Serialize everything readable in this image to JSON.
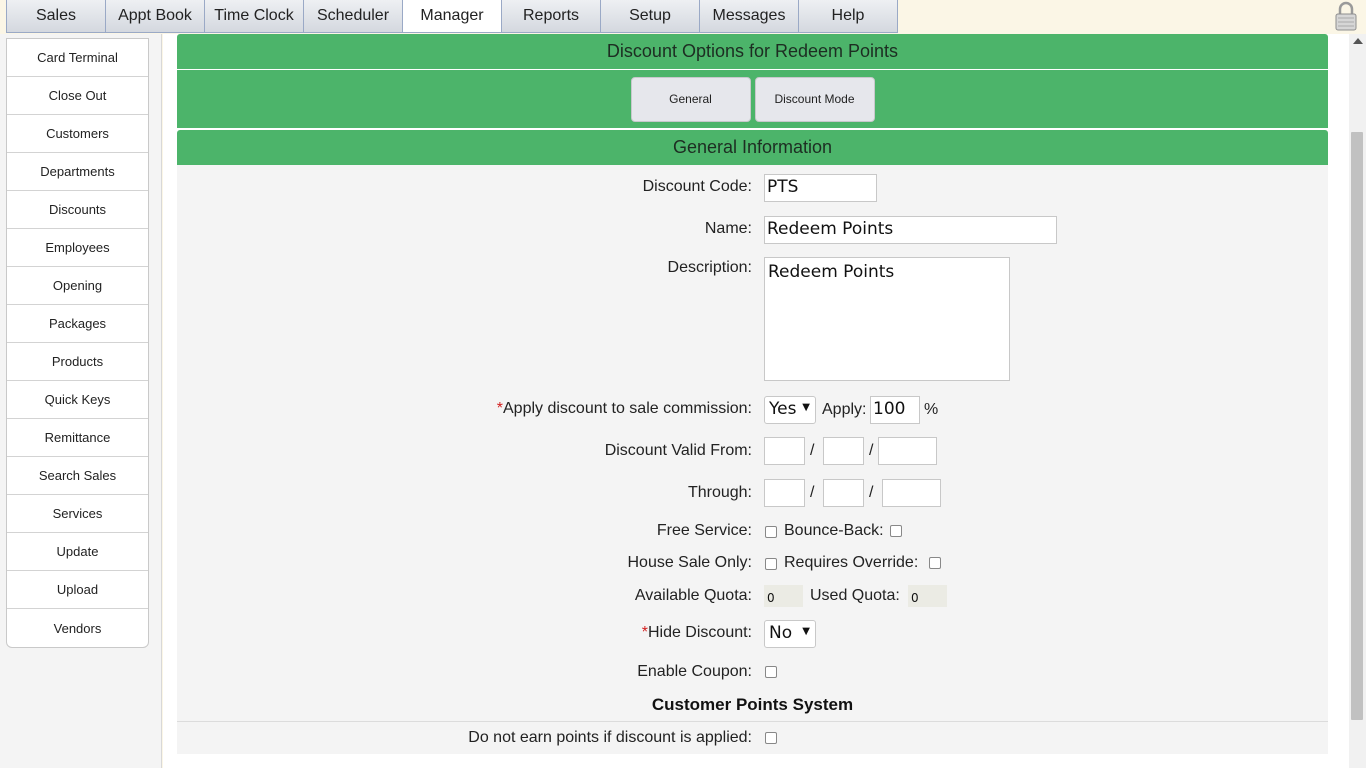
{
  "top_tabs": [
    "Sales",
    "Appt Book",
    "Time Clock",
    "Scheduler",
    "Manager",
    "Reports",
    "Setup",
    "Messages",
    "Help"
  ],
  "active_tab": "Manager",
  "sidebar": {
    "items": [
      "Card Terminal",
      "Close Out",
      "Customers",
      "Departments",
      "Discounts",
      "Employees",
      "Opening",
      "Packages",
      "Products",
      "Quick Keys",
      "Remittance",
      "Search Sales",
      "Services",
      "Update",
      "Upload",
      "Vendors"
    ]
  },
  "header": {
    "title": "Discount Options for Redeem Points"
  },
  "buttons": {
    "general": "General",
    "discount_mode": "Discount Mode"
  },
  "section": {
    "title": "General Information"
  },
  "form": {
    "discount_code_label": "Discount Code:",
    "discount_code_value": "PTS",
    "name_label": "Name:",
    "name_value": "Redeem Points",
    "description_label": "Description:",
    "description_value": "Redeem Points",
    "required_mark": "*",
    "apply_commission_label": "Apply discount to sale commission:",
    "apply_commission_value": "Yes",
    "apply_label": "Apply:",
    "apply_value": "100",
    "percent": "%",
    "valid_from_label": "Discount Valid From:",
    "through_label": "Through:",
    "slash": "/",
    "free_service_label": "Free Service:",
    "bounce_back_label": "Bounce-Back:",
    "house_sale_label": "House Sale Only:",
    "requires_override_label": "Requires Override:",
    "available_quota_label": "Available Quota:",
    "available_quota_value": "0",
    "used_quota_label": "Used Quota:",
    "used_quota_value": "0",
    "hide_discount_label": "Hide Discount:",
    "hide_discount_value": "No",
    "enable_coupon_label": "Enable Coupon:"
  },
  "points_section": {
    "title": "Customer Points System",
    "no_earn_label": "Do not earn points if discount is applied:"
  },
  "icons": {
    "lock": "lock-icon",
    "dropdown": "chevron-down-icon"
  },
  "colors": {
    "green_header": "#4cb46a",
    "form_bg": "#f4f4f4",
    "required": "#d21f1f"
  }
}
